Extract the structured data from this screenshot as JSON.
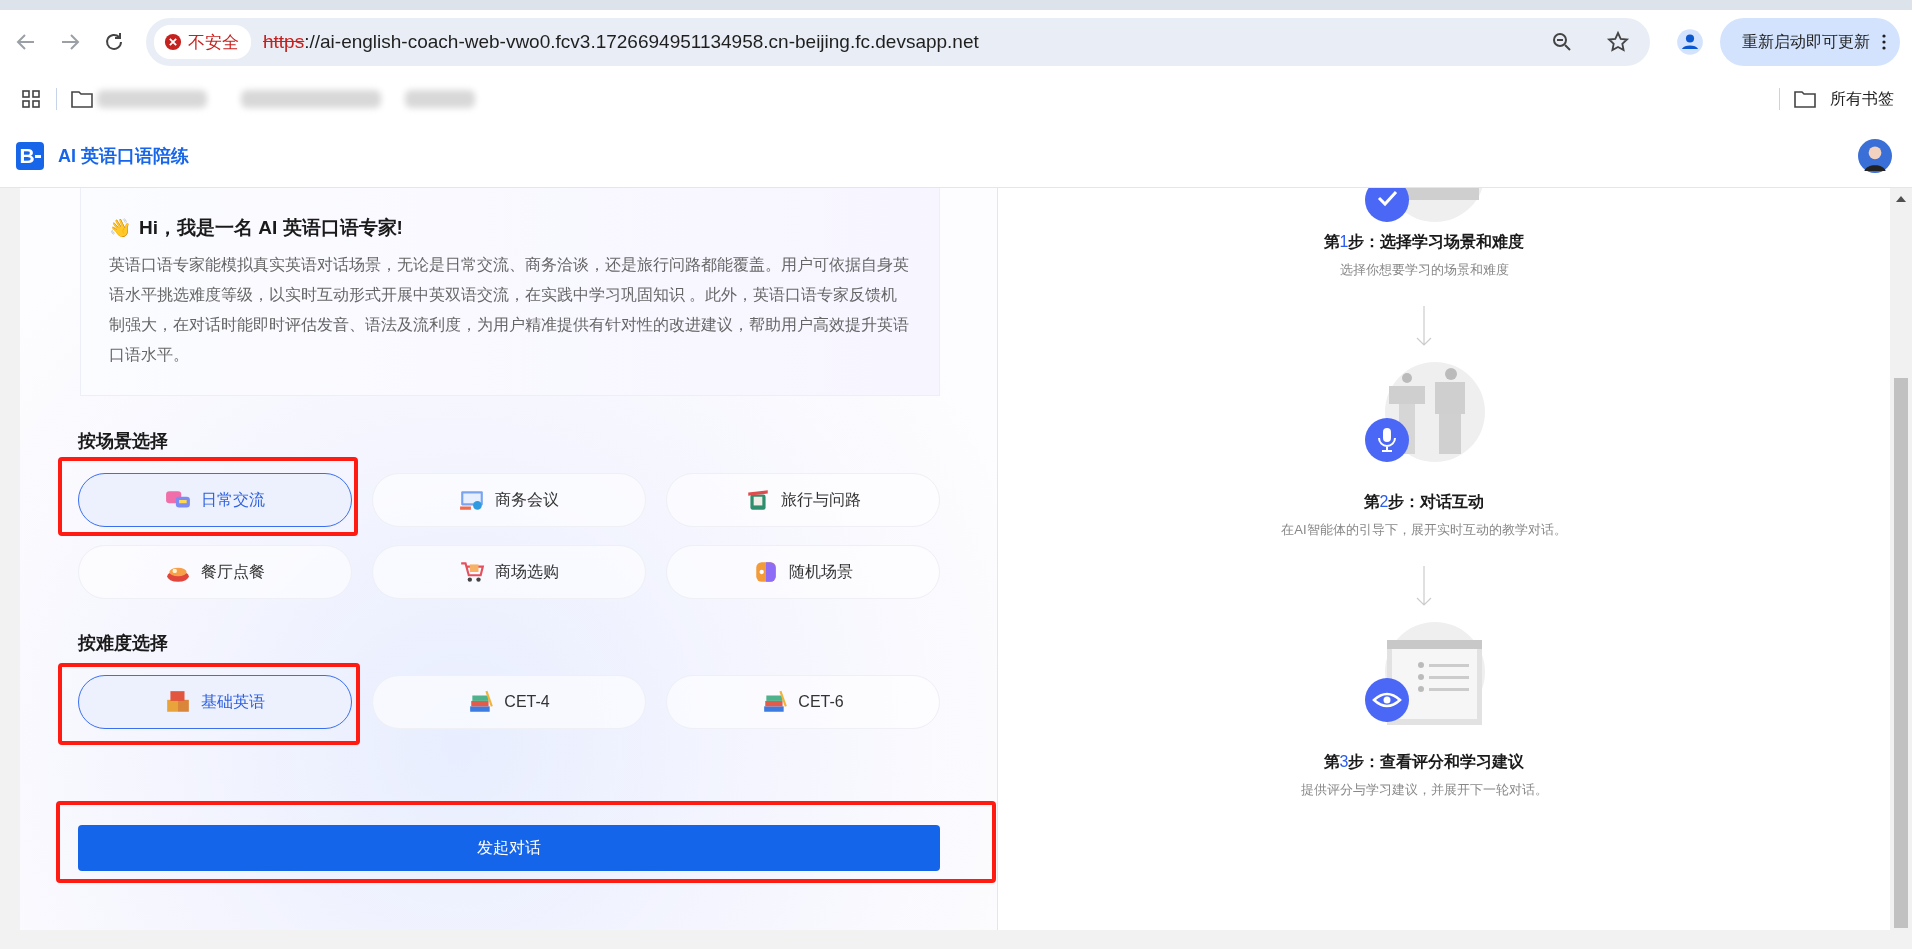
{
  "browser": {
    "security_label": "不安全",
    "url_scheme": "https",
    "url_rest": "://ai-english-coach-web-vwo0.fcv3.1726694951134958.cn-beijing.fc.devsapp.net",
    "update_button": "重新启动即可更新",
    "all_bookmarks": "所有书签"
  },
  "app": {
    "logo_letter": "B",
    "title": "AI 英语口语陪练"
  },
  "intro": {
    "wave": "👋",
    "heading": "Hi，我是一名 AI 英语口语专家!",
    "body": "英语口语专家能模拟真实英语对话场景，无论是日常交流、商务洽谈，还是旅行问路都能覆盖。用户可依据自身英语水平挑选难度等级，以实时互动形式开展中英双语交流，在实践中学习巩固知识 。此外，英语口语专家反馈机制强大，在对话时能即时评估发音、语法及流利度，为用户精准提供有针对性的改进建议，帮助用户高效提升英语口语水平。"
  },
  "scene_section": {
    "title": "按场景选择",
    "options": [
      {
        "label": "日常交流",
        "selected": true,
        "highlighted": true
      },
      {
        "label": "商务会议",
        "selected": false,
        "highlighted": false
      },
      {
        "label": "旅行与问路",
        "selected": false,
        "highlighted": false
      },
      {
        "label": "餐厅点餐",
        "selected": false,
        "highlighted": false
      },
      {
        "label": "商场选购",
        "selected": false,
        "highlighted": false
      },
      {
        "label": "随机场景",
        "selected": false,
        "highlighted": false
      }
    ]
  },
  "difficulty_section": {
    "title": "按难度选择",
    "options": [
      {
        "label": "基础英语",
        "selected": true,
        "highlighted": true
      },
      {
        "label": "CET-4",
        "selected": false,
        "highlighted": false
      },
      {
        "label": "CET-6",
        "selected": false,
        "highlighted": false
      }
    ]
  },
  "start_button": {
    "label": "发起对话",
    "highlighted": true
  },
  "steps": [
    {
      "lead": "第",
      "number": "1",
      "title": "步：选择学习场景和难度",
      "description": "选择你想要学习的场景和难度"
    },
    {
      "lead": "第",
      "number": "2",
      "title": "步：对话互动",
      "description": "在AI智能体的引导下，展开实时互动的教学对话。"
    },
    {
      "lead": "第",
      "number": "3",
      "title": "步：查看评分和学习建议",
      "description": "提供评分与学习建议，并展开下一轮对话。"
    }
  ]
}
